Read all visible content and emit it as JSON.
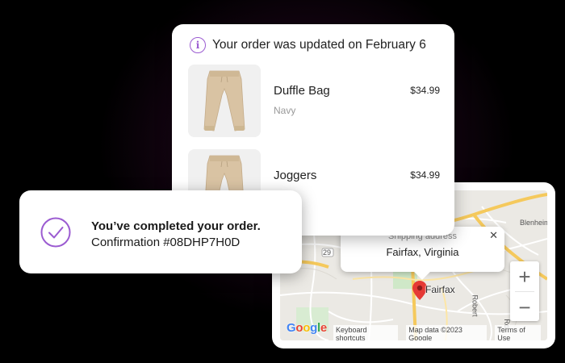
{
  "order_update": {
    "title": "Your order was updated on February 6",
    "icon": "info-icon",
    "items": [
      {
        "name": "Duffle Bag",
        "variant": "Navy",
        "price": "$34.99"
      },
      {
        "name": "Joggers",
        "variant": "",
        "price": "$34.99"
      }
    ]
  },
  "confirmation": {
    "title": "You’ve completed your order.",
    "subtitle": "Confirmation #08DHP7H0D",
    "icon": "check-circle-icon"
  },
  "map": {
    "info_window": {
      "label": "Shipping address",
      "value": "Fairfax, Virginia"
    },
    "pin_city": "Fairfax",
    "place_labels": {
      "blenheim": "Blenheim",
      "robert": "Robert",
      "rd": "Rd",
      "route": "29"
    },
    "zoom_in": "+",
    "zoom_out": "−",
    "google_logo": "Google",
    "footer": {
      "shortcuts": "Keyboard shortcuts",
      "map_data": "Map data ©2023 Google",
      "terms": "Terms of Use"
    }
  },
  "colors": {
    "accent": "#9b5bd1",
    "pin": "#e53935",
    "road_major": "#f7d37a"
  }
}
